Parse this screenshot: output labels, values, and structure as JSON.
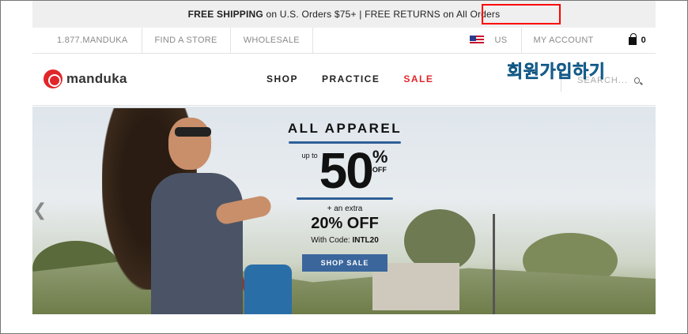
{
  "promo_bar": {
    "shipping_bold": "FREE SHIPPING",
    "shipping_rest": " on U.S. Orders $75+ | ",
    "returns": "FREE RETURNS on All Orders"
  },
  "utility_bar": {
    "phone": "1.877.MANDUKA",
    "find_store": "FIND A STORE",
    "wholesale": "WHOLESALE",
    "region": "US",
    "account": "MY ACCOUNT",
    "cart_count": "0"
  },
  "nav": {
    "logo_text": "manduka",
    "items": [
      {
        "label": "SHOP"
      },
      {
        "label": "PRACTICE"
      },
      {
        "label": "SALE"
      }
    ],
    "search_placeholder": "SEARCH..."
  },
  "annotation": {
    "text": "회원가입하기",
    "color": "#1e8fd6"
  },
  "hero": {
    "title": "ALL APPAREL",
    "up_to": "up to",
    "big_number": "50",
    "percent_sign": "%",
    "off": "OFF",
    "extra": "+ an extra",
    "extra_off": "20% OFF",
    "code_label": "With Code: ",
    "code": "INTL20",
    "button": "SHOP SALE"
  },
  "colors": {
    "brand_red": "#e0262a",
    "button_blue": "#3a669c",
    "highlight_red": "#ff0000"
  }
}
